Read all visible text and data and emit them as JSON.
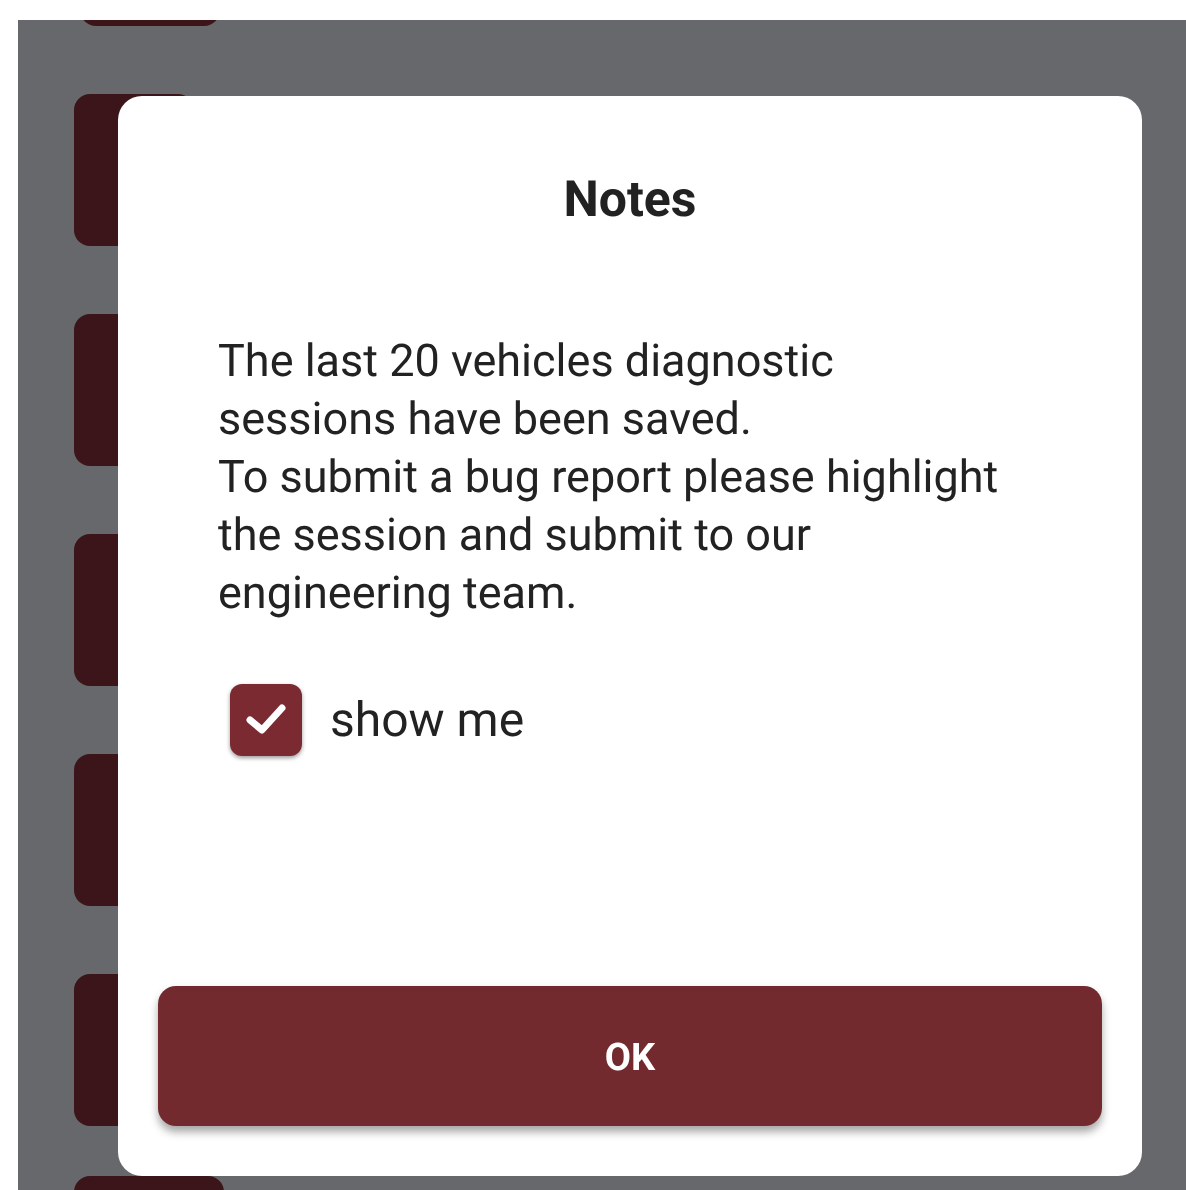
{
  "dialog": {
    "title": "Notes",
    "paragraphs": [
      "The last 20 vehicles diagnostic sessions have been saved.",
      "To submit a bug report please highlight the session and submit to our engineering team."
    ],
    "checkbox": {
      "label": "show me",
      "checked": true
    },
    "button": "OK"
  }
}
